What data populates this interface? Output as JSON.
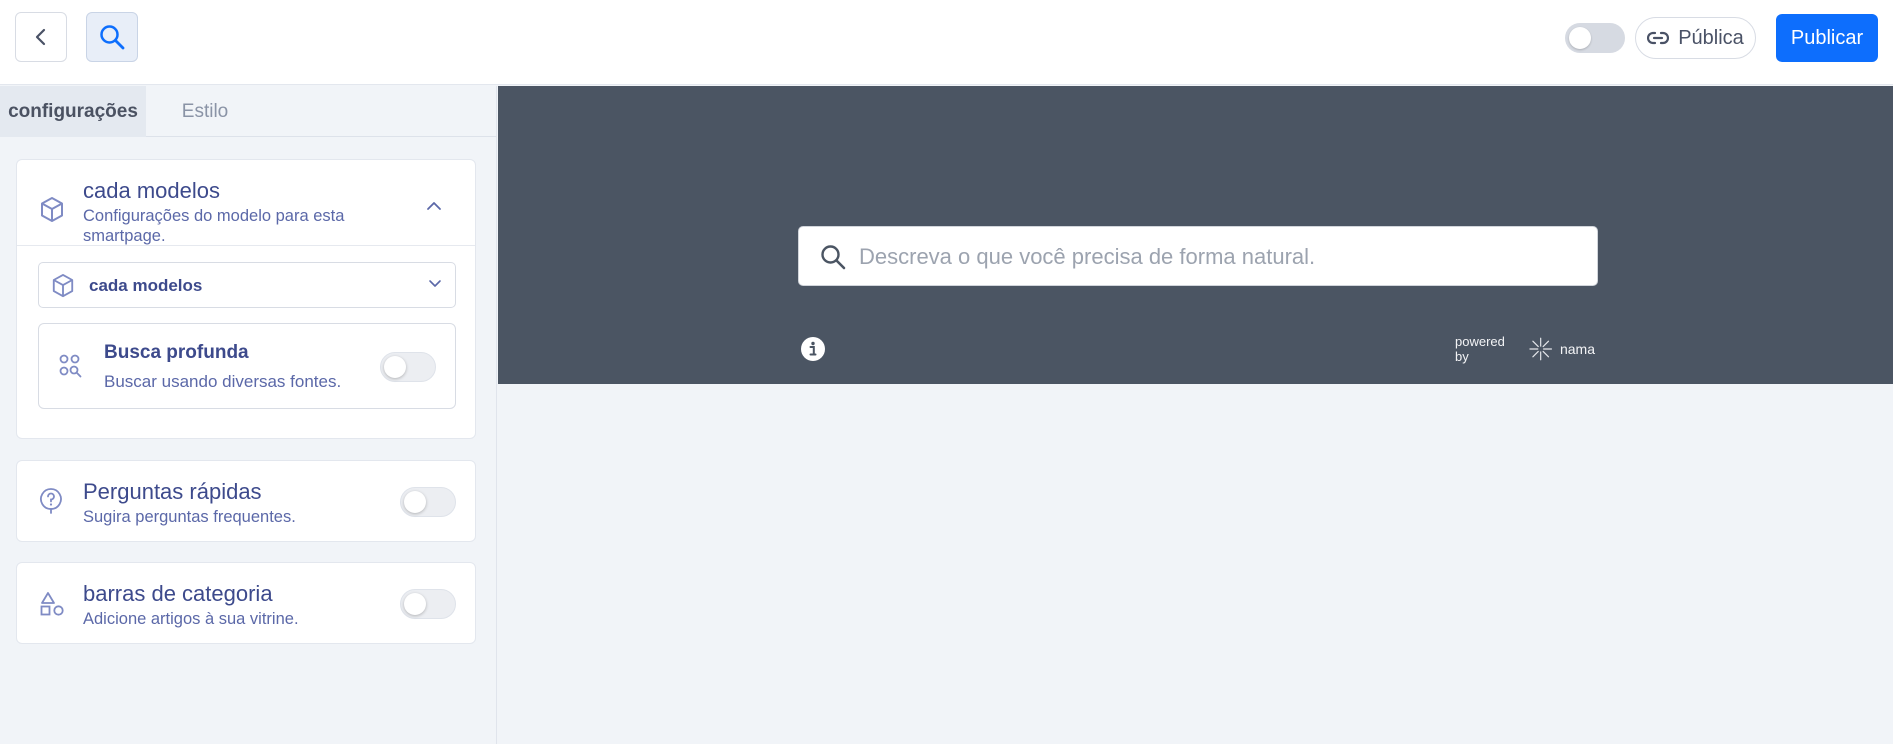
{
  "header": {
    "visibility_label": "Pública",
    "publish_label": "Publicar"
  },
  "sidebar": {
    "tabs": [
      {
        "label": "configurações",
        "active": true
      },
      {
        "label": "Estilo",
        "active": false
      }
    ],
    "models_card": {
      "title": "cada modelos",
      "subtitle": "Configurações do modelo para esta smartpage.",
      "selected_model": "cada modelos",
      "deep_search": {
        "title": "Busca profunda",
        "subtitle": "Buscar usando diversas fontes.",
        "enabled": false
      }
    },
    "quick_questions": {
      "title": "Perguntas rápidas",
      "subtitle": "Sugira perguntas frequentes.",
      "enabled": false
    },
    "category_bars": {
      "title": "barras de categoria",
      "subtitle": "Adicione artigos à sua vitrine.",
      "enabled": false
    }
  },
  "preview": {
    "search_placeholder": "Descreva o que você precisa de forma natural.",
    "powered_by": "powered by",
    "brand": "nama"
  },
  "colors": {
    "accent": "#0d6efd",
    "sidebar_text": "#3d4a8c",
    "preview_bg": "#4b5563"
  }
}
